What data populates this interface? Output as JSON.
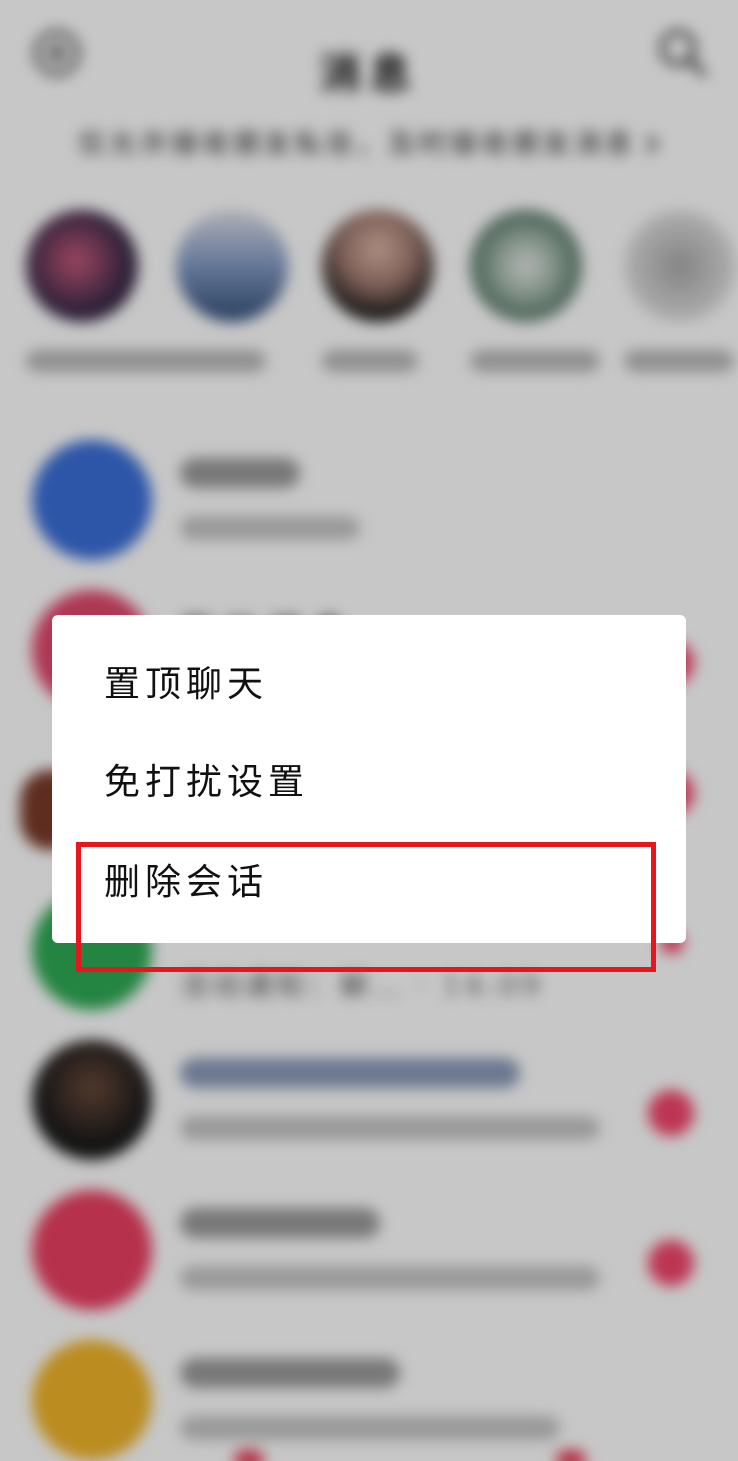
{
  "header": {
    "title": "消息",
    "privacy_notice": "仅允许接收朋友私信，及时接收朋友消息"
  },
  "stories": [
    {
      "name": "story-1",
      "colors": [
        "#3a2a4a",
        "#c85a7a"
      ]
    },
    {
      "name": "story-2",
      "colors": [
        "#5a7aa8",
        "#c8c8d0"
      ]
    },
    {
      "name": "story-3",
      "colors": [
        "#2a2a2a",
        "#c8a090"
      ]
    },
    {
      "name": "story-4",
      "colors": [
        "#7a9a8a",
        "#d8e0d8"
      ]
    },
    {
      "name": "story-5",
      "colors": [
        "#b0b0b0",
        "#e0e0e0"
      ]
    }
  ],
  "conversations": [
    {
      "avatar_color": "#3b6fd8"
    },
    {
      "avatar_color": "#e0476c",
      "name": "互动消息"
    },
    {
      "avatar_color": "#7a3a2a"
    },
    {
      "avatar_color": "#2faa55",
      "preview": "活动通知：解… · 14:09"
    },
    {
      "avatar_color": "#1a1a1a"
    },
    {
      "avatar_color": "#ea3f62"
    },
    {
      "avatar_color": "#f0b429"
    }
  ],
  "menu": {
    "items": [
      "置顶聊天",
      "免打扰设置",
      "删除会话"
    ]
  },
  "colors": {
    "highlight": "#e4161e",
    "badge": "#f2456b"
  }
}
